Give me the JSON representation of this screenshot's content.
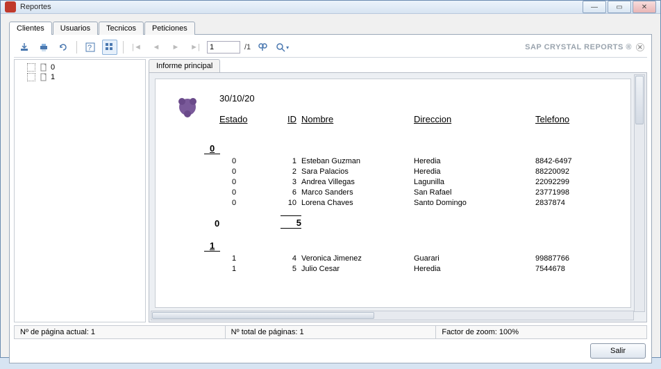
{
  "window": {
    "title": "Reportes"
  },
  "tabs": {
    "clientes": "Clientes",
    "usuarios": "Usuarios",
    "tecnicos": "Tecnicos",
    "peticiones": "Peticiones"
  },
  "toolbar": {
    "page_input": "1",
    "page_total": "/1"
  },
  "brand": "SAP CRYSTAL REPORTS ®",
  "tree": {
    "items": [
      "0",
      "1"
    ]
  },
  "maintab_label": "Informe principal",
  "report": {
    "date": "30/10/20",
    "headers": {
      "estado": "Estado",
      "id": "ID",
      "nombre": "Nombre",
      "direccion": "Direccion",
      "telefono": "Telefono"
    },
    "groups": [
      {
        "key": "0",
        "rows": [
          {
            "estado": "0",
            "id": "1",
            "nombre": "Esteban Guzman",
            "direccion": "Heredia",
            "telefono": "8842-6497"
          },
          {
            "estado": "0",
            "id": "2",
            "nombre": "Sara Palacios",
            "direccion": "Heredia",
            "telefono": "88220092"
          },
          {
            "estado": "0",
            "id": "3",
            "nombre": "Andrea Villegas",
            "direccion": "Lagunilla",
            "telefono": "22092299"
          },
          {
            "estado": "0",
            "id": "6",
            "nombre": "Marco Sanders",
            "direccion": "San Rafael",
            "telefono": "23771998"
          },
          {
            "estado": "0",
            "id": "10",
            "nombre": "Lorena Chaves",
            "direccion": "Santo Domingo",
            "telefono": "2837874"
          }
        ],
        "subtotal_estado": "0",
        "subtotal_count": "5"
      },
      {
        "key": "1",
        "rows": [
          {
            "estado": "1",
            "id": "4",
            "nombre": "Veronica Jimenez",
            "direccion": "Guarari",
            "telefono": "99887766"
          },
          {
            "estado": "1",
            "id": "5",
            "nombre": "Julio Cesar",
            "direccion": "Heredia",
            "telefono": "7544678"
          }
        ]
      }
    ]
  },
  "status": {
    "page_current": "Nº de página actual: 1",
    "page_total": "Nº total de páginas: 1",
    "zoom": "Factor de zoom: 100%"
  },
  "footer": {
    "salir": "Salir"
  }
}
